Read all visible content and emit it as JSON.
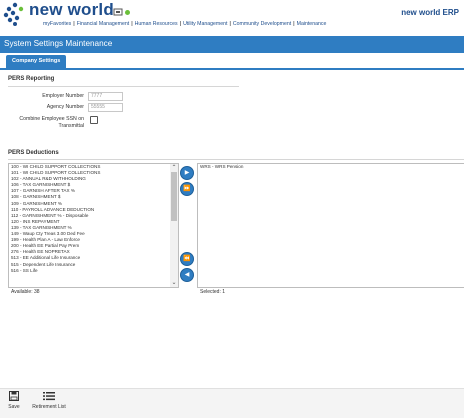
{
  "header": {
    "logo_text": "new world",
    "product_name": "new world ERP",
    "nav": [
      {
        "label": "myFavorites"
      },
      {
        "label": "Financial Management"
      },
      {
        "label": "Human Resources"
      },
      {
        "label": "Utility Management"
      },
      {
        "label": "Community Development"
      },
      {
        "label": "Maintenance"
      }
    ]
  },
  "page": {
    "title": "System Settings Maintenance"
  },
  "tabs": {
    "active": "Company Settings"
  },
  "pers_reporting": {
    "section_title": "PERS Reporting",
    "employer_number_label": "Employer Number",
    "employer_number_value": "7777",
    "agency_number_label": "Agency Number",
    "agency_number_value": "55555",
    "combine_ssn_label_line1": "Combine Employee SSN on",
    "combine_ssn_label_line2": "Transmittal",
    "combine_ssn_checked": false
  },
  "pers_deductions": {
    "section_title": "PERS Deductions",
    "available_items": [
      "100 - WI CHILD SUPPORT COLLECTIONS",
      "101 - WI CHILD SUPPORT COLLECTIONS",
      "102 - ANNUAL R&D WITHHOLDING",
      "106 - TAX GARNISHMENT $",
      "107 - GARNISH AFTER TAX %",
      "108 - GARNISHMENT $",
      "109 - GARNISHMENT %",
      "110 - PAYROLL ADVANCE DEDUCTION",
      "112 - GARNISHMENT % - Disposable",
      "120 - INS REPAYMENT",
      "139 - TAX GARNISHMENT %",
      "149 - Waup Cty Treas 3.00 Ded Fee",
      "199 - Health Plan A - Law Enforce",
      "200 - Health EE Partial Pay Prem",
      "276 - Health EE NOPRETAX",
      "513 - EE Additional Life Insurance",
      "515 - Dependent Life Insurance",
      "516 - SS Life"
    ],
    "selected_items": [
      "WRS - WRS Pension"
    ],
    "available_count_label": "Available: 38",
    "selected_count_label": "Selected: 1"
  },
  "footer": {
    "save_label": "Save",
    "retirement_list_label": "Retirement List"
  },
  "colors": {
    "brand_blue": "#2f7dc2",
    "logo_blue": "#1f4e8c",
    "status_green": "#6bbf3a"
  }
}
